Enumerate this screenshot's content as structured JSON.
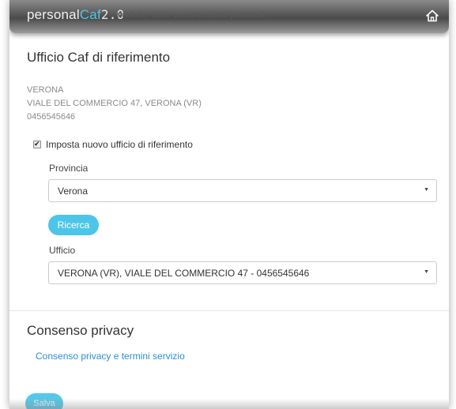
{
  "header": {
    "logo_text_personal": "personal",
    "logo_text_caf": "Caf",
    "logo_version": "2.0",
    "tagline": "notifiche delle comunicazioni personali",
    "home_icon": "home-icon"
  },
  "office_section": {
    "title": "Ufficio Caf di riferimento",
    "current": {
      "city": "VERONA",
      "address": "VIALE DEL COMMERCIO 47, VERONA (VR)",
      "phone": "0456545646"
    },
    "new_office_checkbox": {
      "label": "Imposta nuovo ufficio di riferimento",
      "checked": true
    },
    "provincia": {
      "label": "Provincia",
      "value": "Verona"
    },
    "search_button": "Ricerca",
    "ufficio": {
      "label": "Ufficio",
      "value": "VERONA (VR), VIALE DEL COMMERCIO 47 - 0456545646"
    }
  },
  "privacy_section": {
    "title": "Consenso privacy",
    "link_text": "Consenso privacy e termini servizio"
  },
  "footer": {
    "save_button": "Salva"
  },
  "colors": {
    "accent": "#4cc5e8",
    "link": "#2a8fd8",
    "header_dark": "#4a4a4a"
  }
}
